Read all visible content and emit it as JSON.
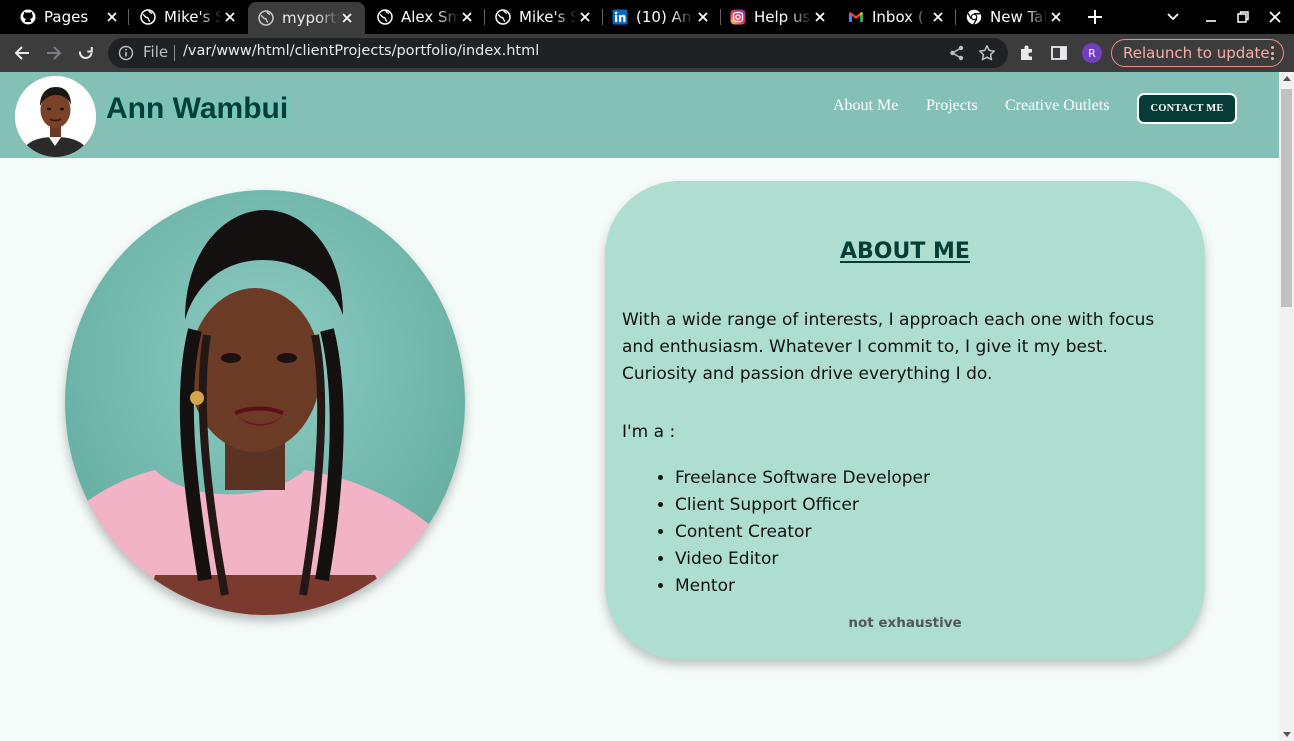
{
  "browser": {
    "tabs": [
      {
        "title": "Pages",
        "icon": "github-icon"
      },
      {
        "title": "Mike's S",
        "icon": "globe-icon"
      },
      {
        "title": "myportf",
        "icon": "globe-icon",
        "active": true
      },
      {
        "title": "Alex Sm",
        "icon": "globe-icon"
      },
      {
        "title": "Mike's S",
        "icon": "globe-icon"
      },
      {
        "title": "(10) Ann",
        "icon": "linkedin-icon"
      },
      {
        "title": "Help us",
        "icon": "instagram-icon"
      },
      {
        "title": "Inbox (",
        "icon": "gmail-icon"
      },
      {
        "title": "New Tal",
        "icon": "chrome-icon"
      }
    ],
    "address": {
      "scheme_label": "File",
      "url": "/var/www/html/clientProjects/portfolio/index.html"
    },
    "profile_initial": "R",
    "relaunch_label": "Relaunch to update"
  },
  "site": {
    "brand": "Ann Wambui",
    "nav": [
      "About Me",
      "Projects",
      "Creative Outlets"
    ],
    "contact_label": "CONTACT ME"
  },
  "about": {
    "title": "ABOUT ME",
    "intro": "With a wide range of interests, I approach each one with focus and enthusiasm. Whatever I commit to, I give it my best. Curiosity and passion drive everything I do.",
    "roles_heading": "I'm a :",
    "roles": [
      "Freelance Software Developer",
      "Client Support Officer",
      "Content Creator",
      "Video Editor",
      "Mentor"
    ],
    "note": "not exhaustive"
  },
  "colors": {
    "header_bg": "#84c0b6",
    "card_bg": "#addecf",
    "brand_text": "#063d36",
    "page_bg": "#f4fbf9"
  }
}
